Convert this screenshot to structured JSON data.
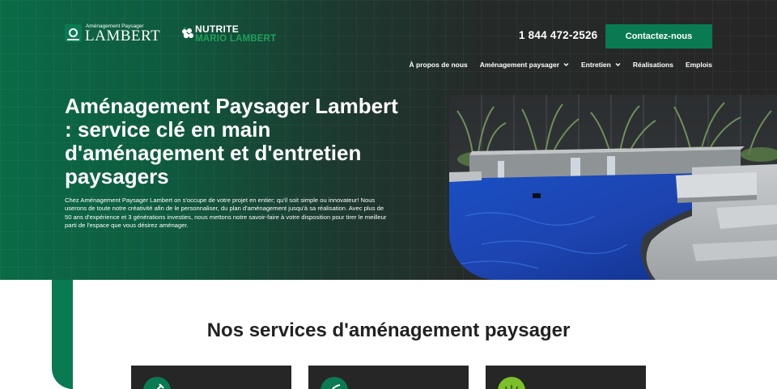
{
  "header": {
    "logo_lambert": {
      "tagline": "Aménagement Paysager",
      "name": "LAMBERT"
    },
    "logo_nutrite": {
      "top": "NUTRITE",
      "bottom": "MARIO LAMBERT"
    },
    "phone": "1 844 472-2526",
    "cta_label": "Contactez-nous",
    "nav": [
      {
        "label": "À propos de nous",
        "has_dropdown": false
      },
      {
        "label": "Aménagement paysager",
        "has_dropdown": true
      },
      {
        "label": "Entretien",
        "has_dropdown": true
      },
      {
        "label": "Réalisations",
        "has_dropdown": false
      },
      {
        "label": "Emplois",
        "has_dropdown": false
      }
    ]
  },
  "hero": {
    "title": "Aménagement Paysager Lambert : service clé en main d'aménagement et d'entretien paysagers",
    "text": "Chez Aménagement Paysager Lambert on s'occupe de votre projet en entier; qu'il soit simple ou innovateur! Nous userons de toute notre créativité afin de le personnaliser, du plan d'aménagement jusqu'à sa réalisation. Avec plus de 50 ans d'expérience et 3 générations investies, nous mettons notre savoir-faire à votre disposition pour tirer le meilleur parti de l'espace que vous désirez aménager."
  },
  "services": {
    "title": "Nos services d'aménagement paysager",
    "cards": [
      {
        "icon": "tool-icon",
        "icon_color": "#0a7a52"
      },
      {
        "icon": "leaf-icon",
        "icon_color": "#0a7a52"
      },
      {
        "icon": "grass-icon",
        "icon_color": "#7bbf2a"
      }
    ]
  },
  "colors": {
    "brand_green": "#0a7a52",
    "dark": "#262626",
    "accent_lime": "#7bbf2a"
  }
}
